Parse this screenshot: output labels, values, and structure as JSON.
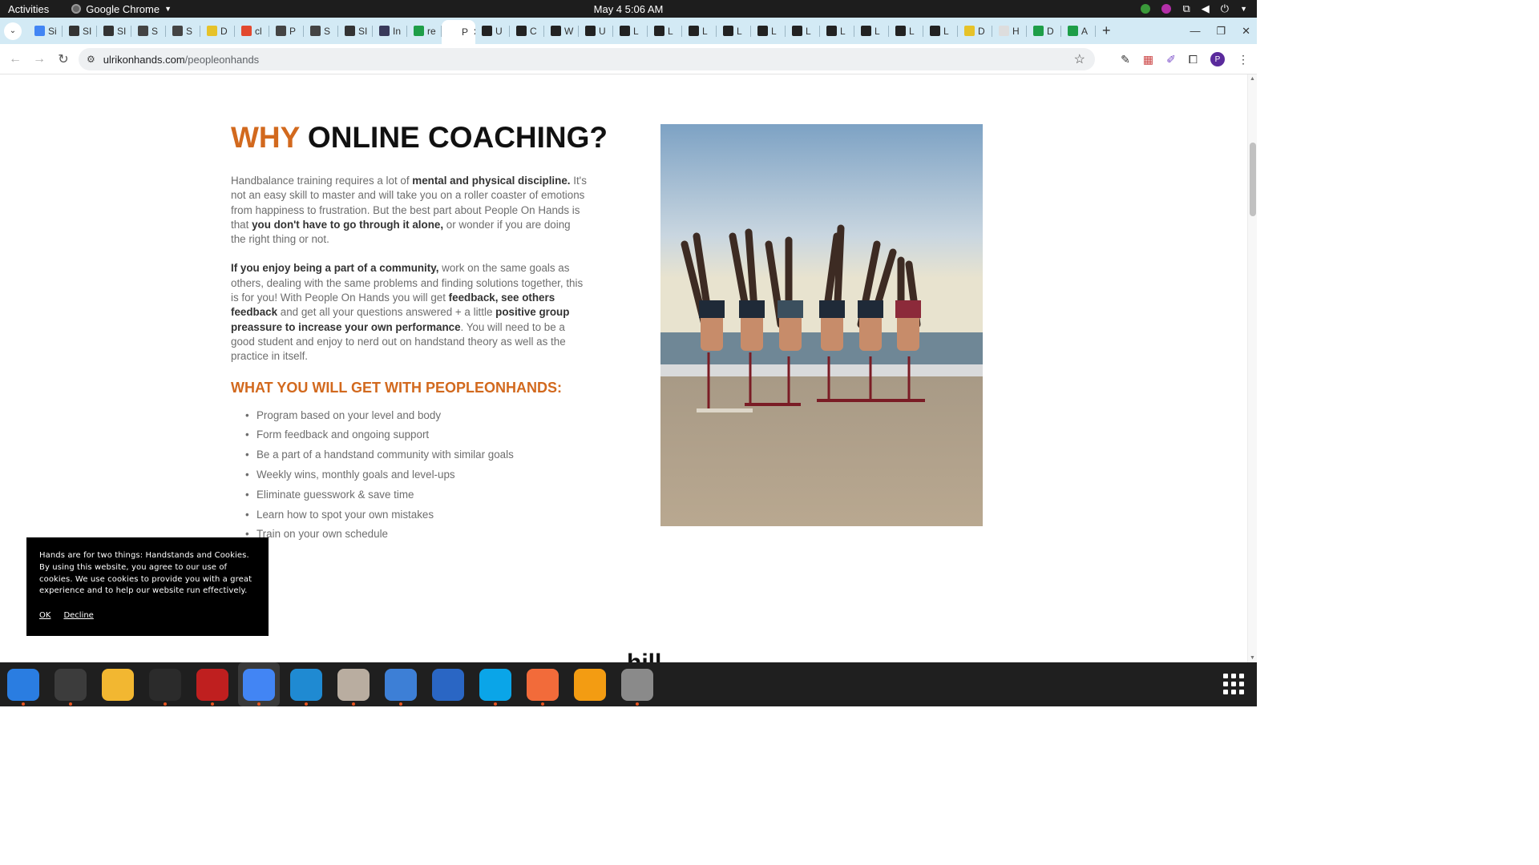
{
  "topbar": {
    "activities": "Activities",
    "app_name": "Google Chrome",
    "clock": "May 4  5:06 AM"
  },
  "tabs": [
    {
      "label": "Si",
      "color": "#4285f4"
    },
    {
      "label": "SI",
      "color": "#333333"
    },
    {
      "label": "SI",
      "color": "#333333"
    },
    {
      "label": "S",
      "color": "#444444"
    },
    {
      "label": "S",
      "color": "#444444"
    },
    {
      "label": "D",
      "color": "#e6c229"
    },
    {
      "label": "cl",
      "color": "#e2492f"
    },
    {
      "label": "P",
      "color": "#444444"
    },
    {
      "label": "S",
      "color": "#444444"
    },
    {
      "label": "SI",
      "color": "#333333"
    },
    {
      "label": "In",
      "color": "#3a3a5a"
    },
    {
      "label": "re",
      "color": "#1e9e48"
    },
    {
      "label": "P",
      "color": "#ffffff",
      "active": true
    },
    {
      "label": "U",
      "color": "#222222"
    },
    {
      "label": "C",
      "color": "#222222"
    },
    {
      "label": "W",
      "color": "#222222"
    },
    {
      "label": "U",
      "color": "#222222"
    },
    {
      "label": "L",
      "color": "#222222"
    },
    {
      "label": "L",
      "color": "#222222"
    },
    {
      "label": "L",
      "color": "#222222"
    },
    {
      "label": "L",
      "color": "#222222"
    },
    {
      "label": "L",
      "color": "#222222"
    },
    {
      "label": "L",
      "color": "#222222"
    },
    {
      "label": "L",
      "color": "#222222"
    },
    {
      "label": "L",
      "color": "#222222"
    },
    {
      "label": "L",
      "color": "#222222"
    },
    {
      "label": "L",
      "color": "#222222"
    },
    {
      "label": "D",
      "color": "#e6c229"
    },
    {
      "label": "H",
      "color": "#dddddd"
    },
    {
      "label": "D",
      "color": "#1e9e48"
    },
    {
      "label": "A",
      "color": "#1e9e48"
    }
  ],
  "address": {
    "domain": "ulrikonhands.com",
    "path": "/peopleonhands"
  },
  "article": {
    "heading_accent": "WHY",
    "heading_rest": " ONLINE COACHING?",
    "p1_a": "Handbalance training requires a lot of ",
    "p1_b": "mental and physical discipline.",
    "p1_c": " It's not an easy skill to master and will take you on a roller coaster of emotions from happiness to frustration. But the best part about People On Hands is that ",
    "p1_d": "you don't have to go through it alone,",
    "p1_e": " or wonder if you are doing the right thing or not.",
    "p2_a": "If you enjoy being a part of a community,",
    "p2_b": " work on the same goals as others, dealing with the same problems and finding solutions together, this is for you! With People On Hands you will get ",
    "p2_c": "feedback, see others feedback",
    "p2_d": " and get all your questions answered + a little ",
    "p2_e": "positive group preassure to increase your own performance",
    "p2_f": ".  You will need to be a good student and enjoy to nerd out on handstand theory as well as the practice in itself.",
    "subheading": "WHAT YOU WILL GET WITH PEOPLEONHANDS:",
    "benefits": [
      "Program based on your level and body",
      "Form feedback and ongoing support",
      "Be a part of a handstand community with similar goals",
      "Weekly wins, monthly goals and level-ups",
      "Eliminate guesswork & save time",
      "Learn how to spot your own mistakes",
      "Train on your own schedule"
    ],
    "peek_heading": "h​i​l​l​"
  },
  "cookie": {
    "text": "Hands are for two things: Handstands and Cookies. By using this website, you agree to our use of cookies. We use cookies to provide you with a great experience and to help our website run effectively.",
    "ok": "OK",
    "decline": "Decline"
  },
  "dock": [
    {
      "name": "thunderbird-icon",
      "color": "#2a7de1"
    },
    {
      "name": "terminal-icon",
      "color": "#3c3c3c"
    },
    {
      "name": "calculator-icon",
      "color": "#f2b731"
    },
    {
      "name": "system-monitor-icon",
      "color": "#2b2b2b"
    },
    {
      "name": "filezilla-icon",
      "color": "#bf1f1f"
    },
    {
      "name": "chrome-icon",
      "color": "#4285f4"
    },
    {
      "name": "vscode-icon",
      "color": "#1f8ad2"
    },
    {
      "name": "files-icon",
      "color": "#b9ada0"
    },
    {
      "name": "text-editor-icon",
      "color": "#3d7fd6"
    },
    {
      "name": "libreoffice-writer-icon",
      "color": "#2a66c4"
    },
    {
      "name": "skype-icon",
      "color": "#0aa5e8"
    },
    {
      "name": "postman-icon",
      "color": "#f26b3a"
    },
    {
      "name": "blender-flame-icon",
      "color": "#f39c12"
    },
    {
      "name": "disk-utility-icon",
      "color": "#8a8a8a"
    }
  ]
}
